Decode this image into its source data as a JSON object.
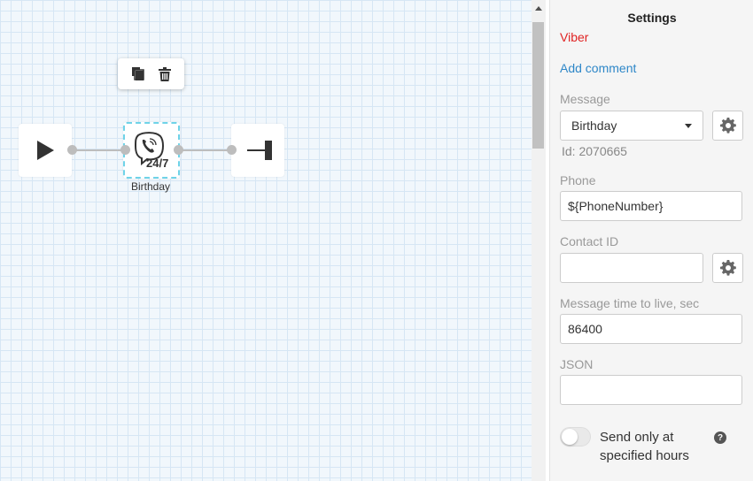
{
  "canvas": {
    "nodes": [
      {
        "id": "start",
        "icon": "play-icon"
      },
      {
        "id": "viber",
        "icon": "viber-24-7-icon",
        "label": "Birthday"
      },
      {
        "id": "end",
        "icon": "end-icon"
      }
    ],
    "toolbar": {
      "copy_icon": "copy-icon",
      "delete_icon": "trash-icon"
    }
  },
  "settings": {
    "title": "Settings",
    "block_type": "Viber",
    "add_comment": "Add comment",
    "message_label": "Message",
    "message_value": "Birthday",
    "message_id": "Id: 2070665",
    "phone_label": "Phone",
    "phone_value": "${PhoneNumber}",
    "contact_id_label": "Contact ID",
    "contact_id_value": "",
    "ttl_label": "Message time to live, sec",
    "ttl_value": "86400",
    "json_label": "JSON",
    "json_value": "",
    "send_hours_label": "Send only at specified hours",
    "send_hours_enabled": false
  },
  "colors": {
    "block_type": "#e02323",
    "link": "#2e87c8",
    "selection": "#6fd3e8"
  }
}
